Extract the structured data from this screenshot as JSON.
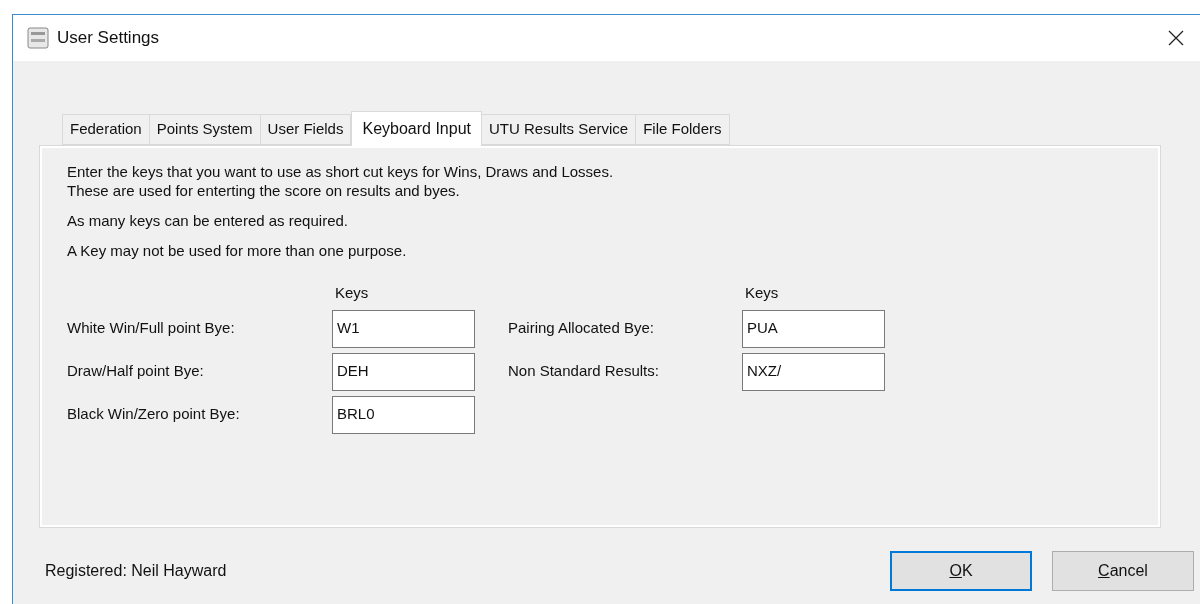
{
  "window": {
    "title": "User Settings"
  },
  "tabs": [
    {
      "label": "Federation",
      "selected": false
    },
    {
      "label": "Points System",
      "selected": false
    },
    {
      "label": "User Fields",
      "selected": false
    },
    {
      "label": "Keyboard Input",
      "selected": true
    },
    {
      "label": "UTU Results Service",
      "selected": false
    },
    {
      "label": "File Folders",
      "selected": false
    }
  ],
  "instructions": [
    [
      "Enter the keys that you want to use as short cut keys for Wins, Draws and Losses.",
      "These are used for enterting the score on results and byes."
    ],
    [
      "As  many keys can be entered as required."
    ],
    [
      "A Key may not be used for more than one purpose."
    ]
  ],
  "columns": [
    {
      "heading": "Keys",
      "fields": [
        {
          "label": "White Win/Full point Bye:",
          "value": "W1"
        },
        {
          "label": "Draw/Half point Bye:",
          "value": "DEH"
        },
        {
          "label": "Black Win/Zero point Bye:",
          "value": "BRL0"
        }
      ]
    },
    {
      "heading": "Keys",
      "fields": [
        {
          "label": "Pairing Allocated Bye:",
          "value": "PUA"
        },
        {
          "label": "Non Standard Results:",
          "value": "NXZ/"
        }
      ]
    }
  ],
  "status": "Registered: Neil Hayward",
  "buttons": [
    {
      "label": "OK",
      "mnemonic_underlined": true,
      "default": true
    },
    {
      "label": "Cancel",
      "mnemonic_underlined": true,
      "default": false
    }
  ]
}
